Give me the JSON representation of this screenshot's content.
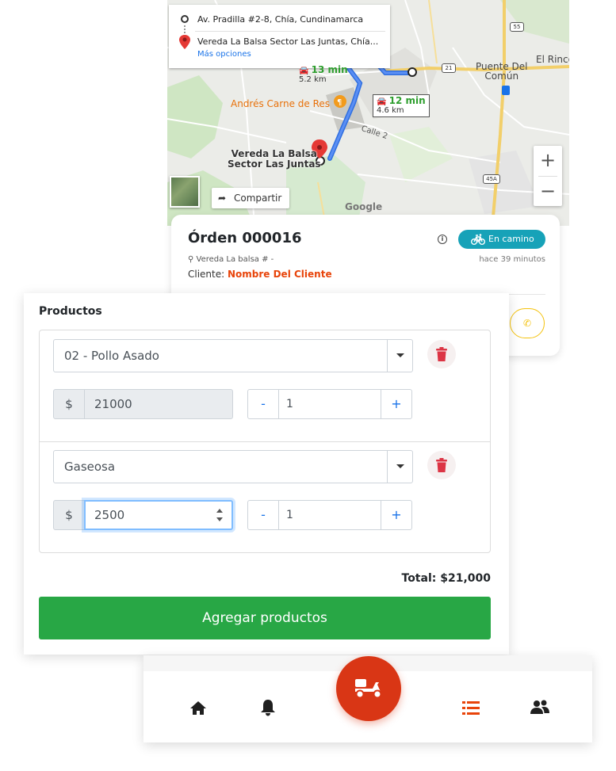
{
  "map": {
    "origin": "Av. Pradilla #2-8, Chía, Cundinamarca",
    "destination": "Vereda La Balsa Sector Las Juntas, Chía...",
    "more_options": "Más opciones",
    "eta_primary": {
      "time": "13 min",
      "distance": "5.2 km"
    },
    "eta_secondary": {
      "time": "12 min",
      "distance": "4.6 km"
    },
    "label_restaurant": "Andrés Carne de Res",
    "label_destination_line1": "Vereda La Balsa",
    "label_destination_line2": "Sector Las Juntas",
    "label_town_line1": "Puente Del",
    "label_town_line2": "Común",
    "label_rinco": "El Rinco",
    "label_street": "Calle 2",
    "label_google": "Google",
    "shield_55": "55",
    "shield_21": "21",
    "shield_45a": "45A",
    "share_label": "Compartir",
    "zoom_in": "+",
    "zoom_out": "−"
  },
  "order": {
    "title": "Órden 000016",
    "status": "En camino",
    "address": "Vereda La balsa # -",
    "time_ago": "hace 39 minutos",
    "client_label": "Cliente: ",
    "client_name": "Nombre Del Cliente"
  },
  "products": {
    "heading": "Productos",
    "items": [
      {
        "name": "02 - Pollo Asado",
        "currency": "$",
        "price": "21000",
        "quantity": "1"
      },
      {
        "name": "Gaseosa",
        "currency": "$",
        "price": "2500",
        "quantity": "1"
      }
    ],
    "minus_label": "-",
    "plus_label": "+",
    "total": "Total: $21,000",
    "add_button": "Agregar productos"
  },
  "colors": {
    "accent_red": "#d93615",
    "status_teal": "#17a2b8",
    "add_green": "#28a745",
    "link_blue": "#1a73e8",
    "call_yellow": "#f4c20d"
  },
  "nav": {
    "items": [
      "home-icon",
      "bell-icon",
      "scooter-icon",
      "list-icon",
      "users-icon"
    ],
    "active": "list-icon"
  }
}
